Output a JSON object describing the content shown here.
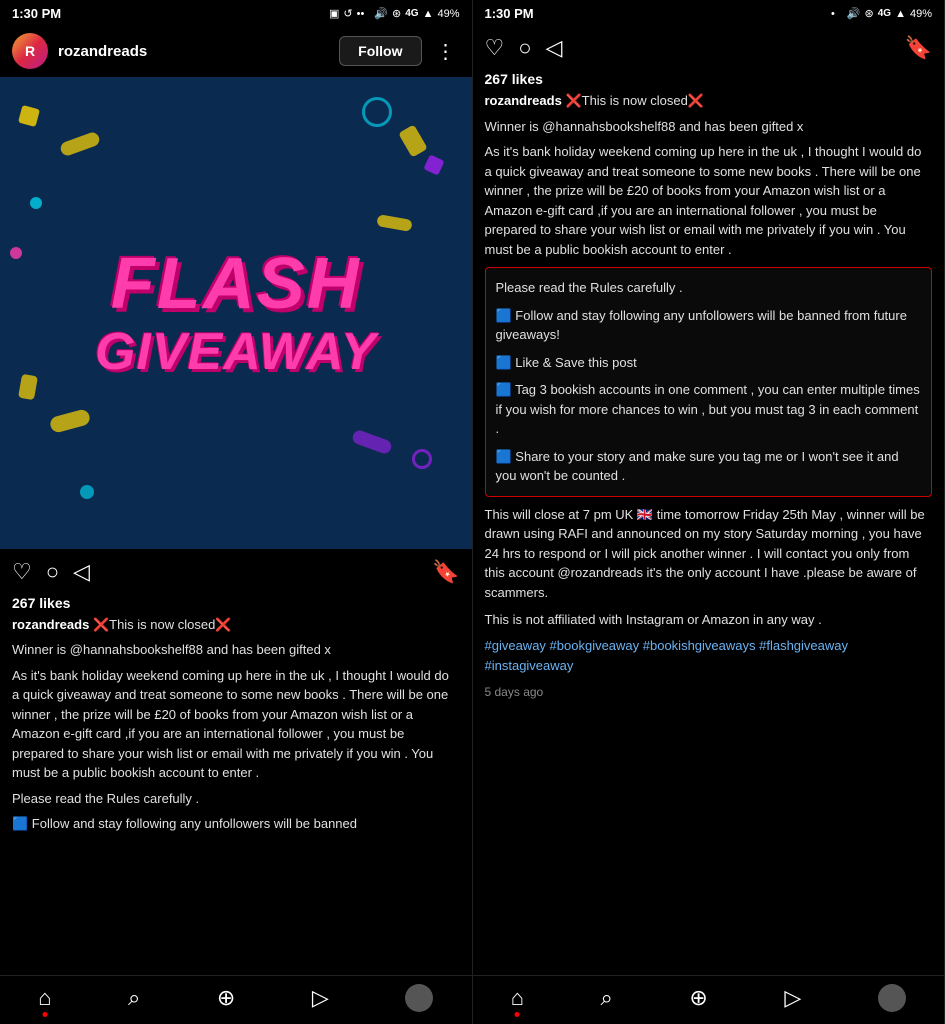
{
  "left": {
    "status_time": "1:30 PM",
    "status_icons": "▣ ↺ ••  🔊 ® 4G ▲ 49%",
    "username": "rozandreads",
    "follow_btn": "Follow",
    "likes": "267 likes",
    "caption_user": "rozandreads",
    "caption_closed": "❌This is now closed❌",
    "winner_line": "Winner is @hannahsbookshelf88 and has been gifted x",
    "body_text": "As it's bank holiday weekend coming up here in the uk , I thought I would do a quick giveaway and treat someone to some new books . There will be one winner , the prize will be £20 of books from your Amazon wish list or a Amazon e-gift card ,if you are an international follower , you must be prepared to share your wish list or email with me privately if you win . You must be a public bookish account to enter .",
    "rules_intro": "Please read the Rules carefully .",
    "rule1_preview": "🟦 Follow and stay following any unfollowers will be banned",
    "bottom_nav": {
      "home": "⌂",
      "search": "🔍",
      "add": "⊕",
      "reels": "▶",
      "profile": ""
    }
  },
  "right": {
    "status_time": "1:30 PM",
    "status_icons": "▣ ↺ ••  🔊 ® 4G ▲ 49%",
    "likes": "267 likes",
    "caption_user": "rozandreads",
    "caption_closed": "❌This is now closed❌",
    "winner_line": "Winner is @hannahsbookshelf88 and has been gifted x",
    "body_text": "As it's bank holiday weekend coming up here in the uk , I thought I would do a quick giveaway and treat someone to some new books . There will be one winner , the prize will be £20 of books from your Amazon wish list or a Amazon e-gift card ,if you are an international follower , you must be prepared to share your wish list or email with me privately if you win . You must be a public bookish account to enter .",
    "rules_intro": "Please read the Rules carefully .",
    "rule1": "🟦 Follow and stay following any unfollowers will be banned from future giveaways!",
    "rule2": "🟦 Like & Save this post",
    "rule3": "🟦 Tag 3 bookish accounts in one comment , you can enter multiple times if you wish for more chances to win , but you must tag 3 in each comment .",
    "rule4": "🟦 Share to your story and make sure you tag me or I won't see it and you won't be counted .",
    "closing_text": "This will close at 7 pm UK 🇬🇧 time tomorrow Friday 25th May , winner will be drawn using RAFI and announced on my story Saturday morning , you have 24 hrs to respond or I will pick another winner . I will contact you only from this account @rozandreads it's the only account I have .please be aware of scammers.",
    "affiliate_text": "This is not affiliated with Instagram or Amazon in any way .",
    "hashtags": "#giveaway #bookgiveaway #bookishgiveaways #flashgiveaway #instagiveaway",
    "timestamp": "5 days ago",
    "bottom_nav": {
      "home": "⌂",
      "search": "🔍",
      "add": "⊕",
      "reels": "▶",
      "profile": ""
    }
  }
}
